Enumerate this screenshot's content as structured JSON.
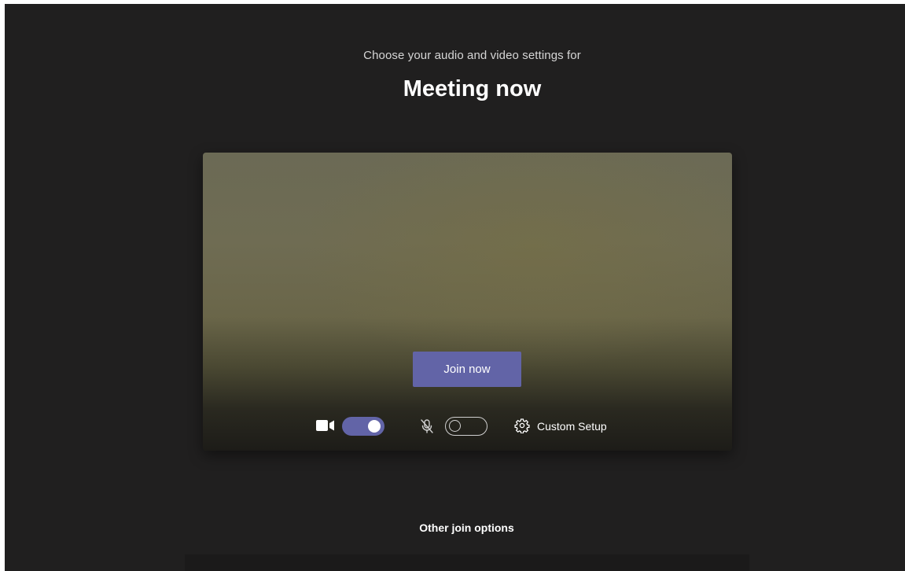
{
  "prejoin": {
    "subtitle": "Choose your audio and video settings for",
    "meeting_title": "Meeting now"
  },
  "preview": {
    "join_label": "Join now"
  },
  "controls": {
    "camera": {
      "icon": "video-camera-icon",
      "state": "on"
    },
    "microphone": {
      "icon": "mic-off-icon",
      "state": "off"
    },
    "settings": {
      "icon": "gear-icon",
      "label": "Custom Setup"
    }
  },
  "other_join_options": "Other join options",
  "colors": {
    "background": "#201f1f",
    "accent": "#6264a7",
    "text": "#ffffff"
  }
}
